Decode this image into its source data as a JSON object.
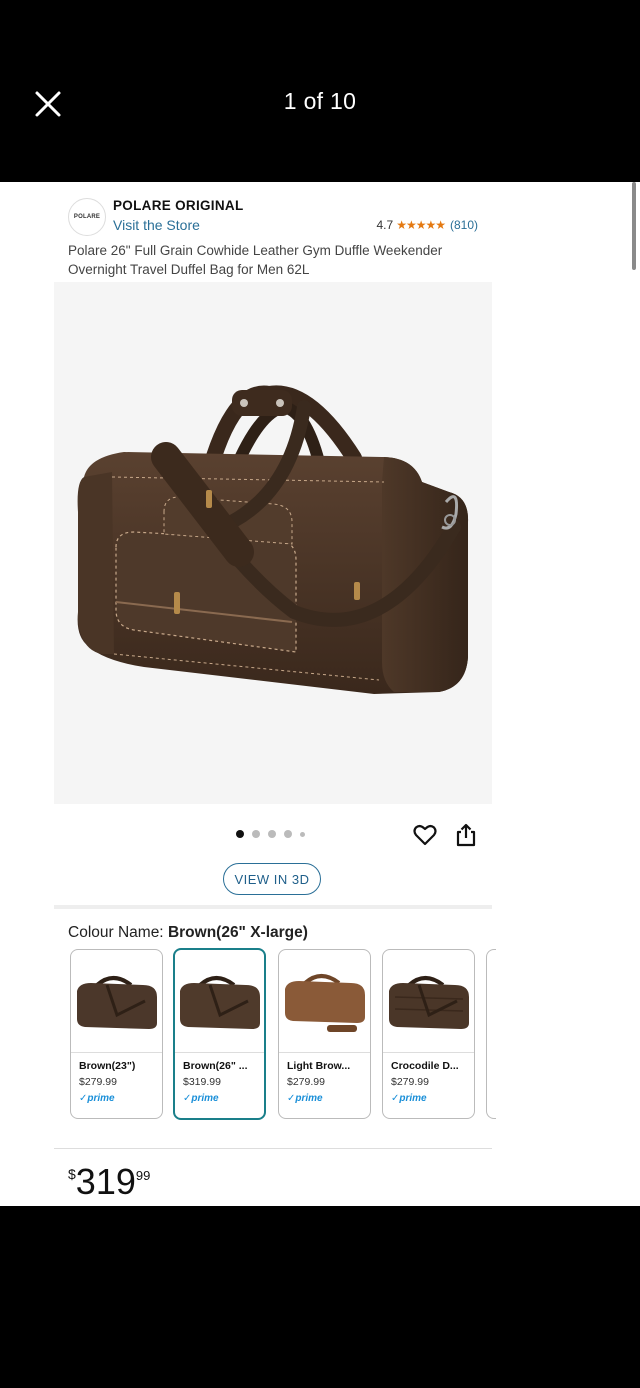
{
  "viewer": {
    "counter": "1 of 10"
  },
  "brand": {
    "logo_text": "POLARE",
    "name": "POLARE ORIGINAL",
    "visit_store": "Visit the Store"
  },
  "rating": {
    "value": "4.7",
    "stars": "★★★★★",
    "count": "(810)"
  },
  "product": {
    "title": "Polare 26\" Full Grain Cowhide Leather Gym Duffle Weekender Overnight Travel Duffel Bag for Men 62L"
  },
  "carousel": {
    "dots": 5,
    "active_index": 0
  },
  "view3d_label": "VIEW IN 3D",
  "colour": {
    "label": "Colour Name:",
    "selected": "Brown(26\" X-large)",
    "options": [
      {
        "name": "Brown(23\")",
        "price": "$279.99",
        "prime": "✓prime",
        "color": "#4b372a"
      },
      {
        "name": "Brown(26\" ...",
        "price": "$319.99",
        "prime": "✓prime",
        "color": "#4f3a2b"
      },
      {
        "name": "Light Brow...",
        "price": "$279.99",
        "prime": "✓prime",
        "color": "#8a5a38"
      },
      {
        "name": "Crocodile D...",
        "price": "$279.99",
        "prime": "✓prime",
        "color": "#4a3628"
      }
    ]
  },
  "price": {
    "symbol": "$",
    "whole": "319",
    "fraction": "99"
  },
  "colors": {
    "accent": "#1a7f8a",
    "link": "#2a6f97",
    "star": "#e47911",
    "leather": "#4a3526"
  }
}
